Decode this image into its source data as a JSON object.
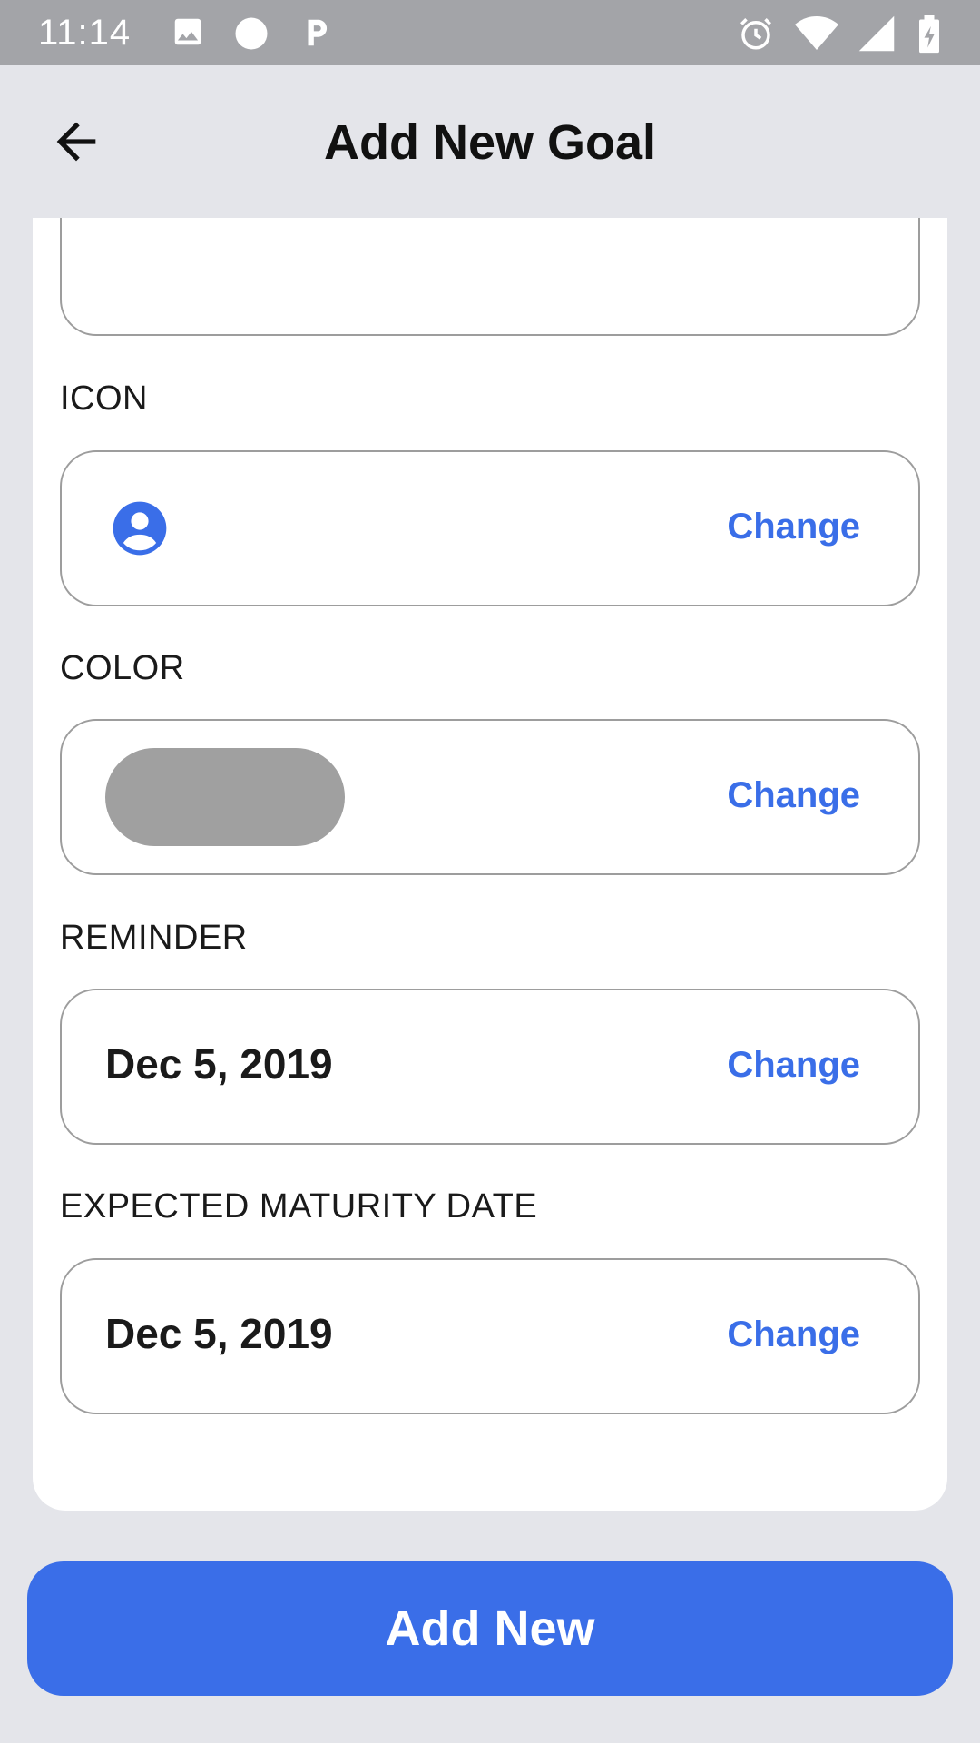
{
  "status_bar": {
    "time": "11:14"
  },
  "header": {
    "title": "Add New Goal"
  },
  "form": {
    "icon": {
      "label": "ICON",
      "change_label": "Change",
      "icon_name": "account-circle-icon",
      "icon_color": "#3a6ee8"
    },
    "color": {
      "label": "COLOR",
      "change_label": "Change",
      "value": "#a0a0a0"
    },
    "reminder": {
      "label": "REMINDER",
      "value": "Dec 5, 2019",
      "change_label": "Change"
    },
    "maturity": {
      "label": "EXPECTED MATURITY DATE",
      "value": "Dec 5, 2019",
      "change_label": "Change"
    }
  },
  "footer": {
    "add_label": "Add New"
  },
  "colors": {
    "accent": "#3a6ee8",
    "background": "#e4e5ea",
    "status_bar": "#a3a4a8"
  }
}
